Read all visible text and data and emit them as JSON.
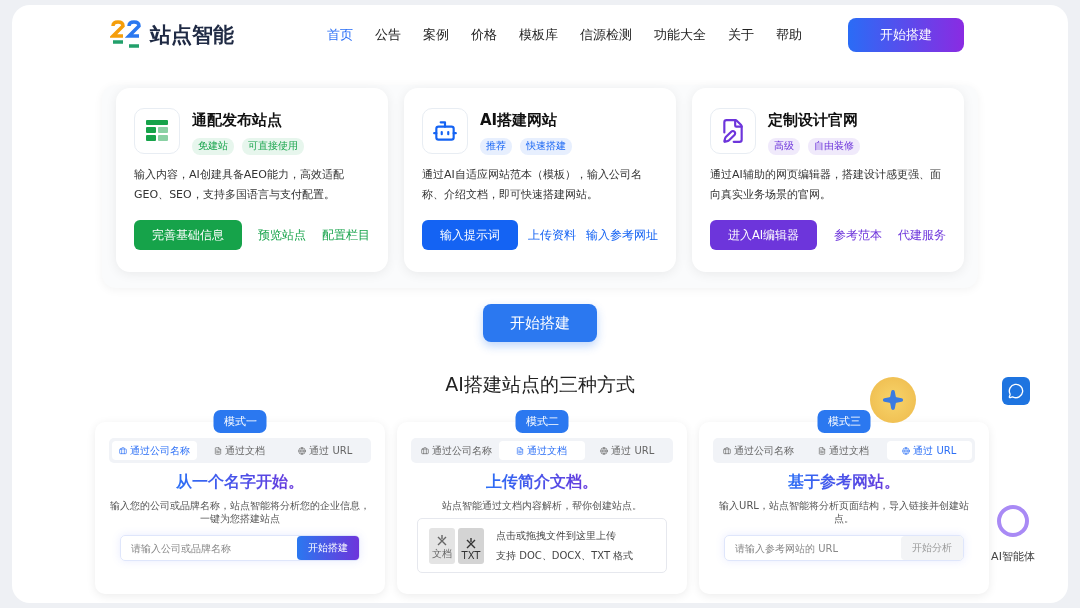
{
  "header": {
    "logo_text": "站点智能",
    "nav": [
      {
        "label": "首页",
        "selected": true
      },
      {
        "label": "公告",
        "selected": false
      },
      {
        "label": "案例",
        "selected": false
      },
      {
        "label": "价格",
        "selected": false
      },
      {
        "label": "模板库",
        "selected": false
      },
      {
        "label": "信源检测",
        "selected": false
      },
      {
        "label": "功能大全",
        "selected": false
      },
      {
        "label": "关于",
        "selected": false
      },
      {
        "label": "帮助",
        "selected": false
      }
    ],
    "cta": "开始搭建"
  },
  "features": [
    {
      "kind": "sheet",
      "color": "#16a34a",
      "title": "通配发布站点",
      "tags": [
        "免建站",
        "可直接使用"
      ],
      "description": "输入内容，AI创建具备AEO能力，高效适配GEO、SEO，支持多国语言与支付配置。",
      "primary": "完善基础信息",
      "links": [
        "预览站点",
        "配置栏目"
      ]
    },
    {
      "kind": "robot",
      "color": "#1463f3",
      "title": "AI搭建网站",
      "tags": [
        "推荐",
        "快速搭建"
      ],
      "description": "通过AI自适应网站范本（模板），输入公司名称、介绍文档，即可快速搭建网站。",
      "primary": "输入提示词",
      "links": [
        "上传资料",
        "输入参考网址"
      ]
    },
    {
      "kind": "pen",
      "color": "#6d35db",
      "title": "定制设计官网",
      "tags": [
        "高级",
        "自由装修"
      ],
      "description": "通过AI辅助的网页编辑器，搭建设计感更强、面向真实业务场景的官网。",
      "primary": "进入AI编辑器",
      "links": [
        "参考范本",
        "代建服务"
      ]
    }
  ],
  "start_button": "开始搭建",
  "modes_title": "AI搭建站点的三种方式",
  "modes": [
    {
      "badge": "模式一",
      "kind": "search",
      "tabs": [
        {
          "label": "通过公司名称",
          "selected": true
        },
        {
          "label": "通过文档",
          "selected": false
        },
        {
          "label": "通过 URL",
          "selected": false
        }
      ],
      "headline": "从一个名字开始。",
      "description": "输入您的公司或品牌名称，站点智能将分析您的企业信息，一键为您搭建站点",
      "placeholder": "请输入公司或品牌名称",
      "button": {
        "label": "开始搭建",
        "disabled": false
      }
    },
    {
      "badge": "模式二",
      "kind": "upload",
      "tabs": [
        {
          "label": "通过公司名称",
          "selected": false
        },
        {
          "label": "通过文档",
          "selected": true
        },
        {
          "label": "通过 URL",
          "selected": false
        }
      ],
      "headline": "上传简介文档。",
      "description": "站点智能通过文档内容解析，帮你创建站点。",
      "file_badges": [
        "文档",
        "TXT"
      ],
      "prompt": "点击或拖拽文件到这里上传",
      "formats": "支持 DOC、DOCX、TXT 格式"
    },
    {
      "badge": "模式三",
      "kind": "search",
      "tabs": [
        {
          "label": "通过公司名称",
          "selected": false
        },
        {
          "label": "通过文档",
          "selected": false
        },
        {
          "label": "通过 URL",
          "selected": true
        }
      ],
      "headline": "基于参考网站。",
      "description": "输入URL，站点智能将分析页面结构，导入链接并创建站点。",
      "placeholder": "请输入参考网站的 URL",
      "button": {
        "label": "开始分析",
        "disabled": true
      }
    }
  ],
  "assistant": {
    "label": "AI智能体"
  }
}
